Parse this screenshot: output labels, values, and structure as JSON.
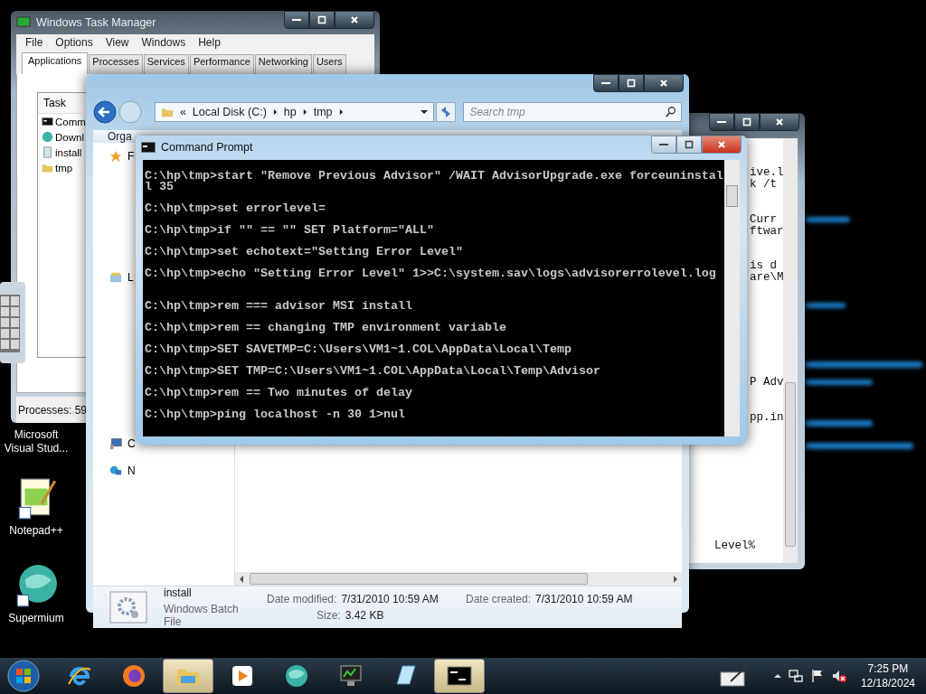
{
  "desktop_icons": [
    {
      "label": "Microsoft Visual Stud...",
      "kind": "hidden"
    },
    {
      "label": "Notepad++",
      "kind": "notepad"
    },
    {
      "label": "Supermium",
      "kind": "globe"
    }
  ],
  "task_manager": {
    "title": "Windows Task Manager",
    "menu": [
      "File",
      "Options",
      "View",
      "Windows",
      "Help"
    ],
    "tabs": [
      {
        "label": "Applications",
        "selected": true
      },
      {
        "label": "Processes",
        "selected": false
      },
      {
        "label": "Services",
        "selected": false
      },
      {
        "label": "Performance",
        "selected": false
      },
      {
        "label": "Networking",
        "selected": false
      },
      {
        "label": "Users",
        "selected": false
      }
    ],
    "list_header": "Task",
    "tasks": [
      {
        "label": "Comm",
        "kind": "console"
      },
      {
        "label": "Downl",
        "kind": "globe"
      },
      {
        "label": "install",
        "kind": "batch"
      },
      {
        "label": "tmp",
        "kind": "folder"
      }
    ],
    "status": "Processes: 59"
  },
  "editor": {
    "lines": [
      "ive.l",
      "k /t",
      "Curr",
      "ftwar",
      "is d",
      "are\\M",
      "P Adv",
      "pp.in",
      "Level%"
    ]
  },
  "explorer": {
    "overflow": "«",
    "breadcrumb": [
      "Local Disk (C:)",
      "hp",
      "tmp"
    ],
    "search": {
      "placeholder": "Search tmp"
    },
    "toolbar": "Orga",
    "nav_items": [
      {
        "label": "F",
        "kind": "star"
      },
      {
        "label": "L",
        "kind": "library"
      },
      {
        "label": "C",
        "kind": "computer"
      },
      {
        "label": "N",
        "kind": "network"
      }
    ],
    "details": {
      "name": "install",
      "type": "Windows Batch File",
      "fields": [
        {
          "label": "Date modified:",
          "value": "7/31/2010 10:59 AM"
        },
        {
          "label": "Date created:",
          "value": "7/31/2010 10:59 AM"
        },
        {
          "label": "Size:",
          "value": "3.42 KB"
        }
      ]
    }
  },
  "command_prompt": {
    "title": "Command Prompt",
    "output": "C:\\hp\\tmp>start \"Remove Previous Advisor\" /WAIT AdvisorUpgrade.exe forceuninstall 35\n\nC:\\hp\\tmp>set errorlevel=\n\nC:\\hp\\tmp>if \"\" == \"\" SET Platform=\"ALL\"\n\nC:\\hp\\tmp>set echotext=\"Setting Error Level\"\n\nC:\\hp\\tmp>echo \"Setting Error Level\" 1>>C:\\system.sav\\logs\\advisorerrolevel.log\n\n\nC:\\hp\\tmp>rem === advisor MSI install\n\nC:\\hp\\tmp>rem == changing TMP environment variable\n\nC:\\hp\\tmp>SET SAVETMP=C:\\Users\\VM1~1.COL\\AppData\\Local\\Temp\n\nC:\\hp\\tmp>SET TMP=C:\\Users\\VM1~1.COL\\AppData\\Local\\Temp\\Advisor\n\nC:\\hp\\tmp>rem == Two minutes of delay\n\nC:\\hp\\tmp>ping localhost -n 30 1>nul"
  },
  "taskbar": {
    "apps": [
      {
        "kind": "ie",
        "selected": false
      },
      {
        "kind": "firefox",
        "selected": false
      },
      {
        "kind": "folder",
        "selected": true
      },
      {
        "kind": "media",
        "selected": false
      },
      {
        "kind": "globe",
        "selected": false
      },
      {
        "kind": "monitor",
        "selected": false
      },
      {
        "kind": "notepad",
        "selected": false
      },
      {
        "kind": "console",
        "selected": true
      }
    ],
    "clock": {
      "time": "7:25 PM",
      "date": "12/18/2024"
    }
  }
}
